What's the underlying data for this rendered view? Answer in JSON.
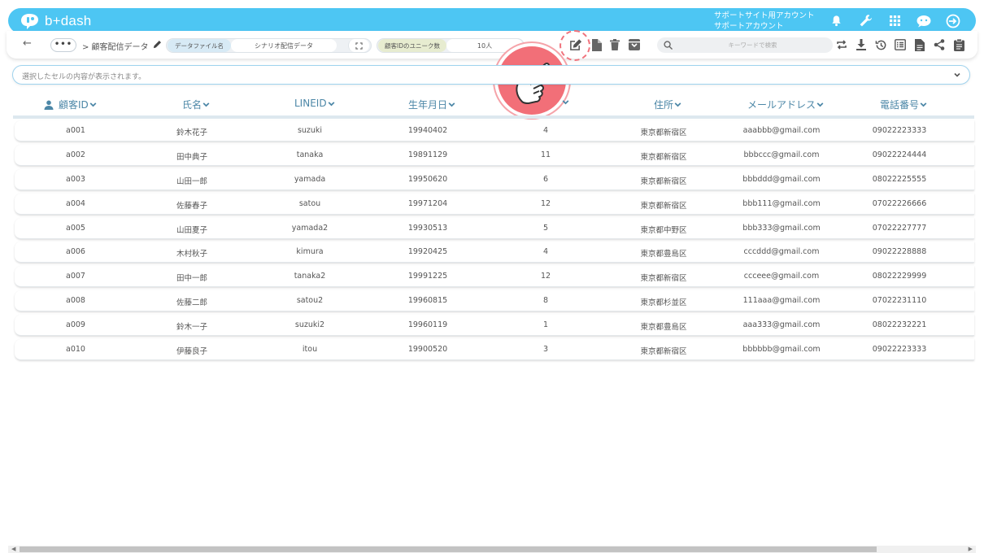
{
  "app": {
    "logo_text": "b+dash",
    "account_line1": "サポートサイト用アカウント",
    "account_line2": "サポートアカウント"
  },
  "toolbar": {
    "breadcrumb": "> 顧客配信データ",
    "data_file_chip": "データファイル名",
    "data_file_value": "シナリオ配信データ",
    "unique_chip": "顧客IDのユニーク数",
    "unique_value": "10人",
    "search_placeholder": "キーワードで検索"
  },
  "cell_bar": {
    "placeholder": "選択したセルの内容が表示されます。"
  },
  "table": {
    "columns": [
      "顧客ID",
      "氏名",
      "LINEID",
      "生年月日",
      "",
      "住所",
      "メールアドレス",
      "電話番号"
    ],
    "rows": [
      [
        "a001",
        "鈴木花子",
        "suzuki",
        "19940402",
        "4",
        "東京都新宿区",
        "aaabbb@gmail.com",
        "09022223333"
      ],
      [
        "a002",
        "田中典子",
        "tanaka",
        "19891129",
        "11",
        "東京都新宿区",
        "bbbccc@gmail.com",
        "09022224444"
      ],
      [
        "a003",
        "山田一郎",
        "yamada",
        "19950620",
        "6",
        "東京都新宿区",
        "bbbddd@gmail.com",
        "08022225555"
      ],
      [
        "a004",
        "佐藤春子",
        "satou",
        "19971204",
        "12",
        "東京都新宿区",
        "bbb111@gmail.com",
        "07022226666"
      ],
      [
        "a005",
        "山田夏子",
        "yamada2",
        "19930513",
        "5",
        "東京都中野区",
        "bbb333@gmail.com",
        "07022227777"
      ],
      [
        "a006",
        "木村秋子",
        "kimura",
        "19920425",
        "4",
        "東京都豊島区",
        "cccddd@gmail.com",
        "09022228888"
      ],
      [
        "a007",
        "田中一郎",
        "tanaka2",
        "19991225",
        "12",
        "東京都新宿区",
        "ccceee@gmail.com",
        "08022229999"
      ],
      [
        "a008",
        "佐藤二郎",
        "satou2",
        "19960815",
        "8",
        "東京都杉並区",
        "111aaa@gmail.com",
        "07022231110"
      ],
      [
        "a009",
        "鈴木一子",
        "suzuki2",
        "19960119",
        "1",
        "東京都豊島区",
        "aaa333@gmail.com",
        "08022232221"
      ],
      [
        "a010",
        "伊藤良子",
        "itou",
        "19900520",
        "3",
        "東京都新宿区",
        "bbbbbb@gmail.com",
        "09022223333"
      ]
    ]
  },
  "icons": {
    "top": [
      "bell-icon",
      "wrench-icon",
      "grid-icon",
      "chat-bot-icon",
      "logout-icon"
    ],
    "tools": [
      "edit-icon",
      "file-icon",
      "trash-icon",
      "archive-icon"
    ],
    "right_tools": [
      "swap-icon",
      "download-icon",
      "history-icon",
      "list-icon",
      "document-icon",
      "share-icon",
      "clipboard-icon"
    ]
  },
  "colors": {
    "brand": "#4dc6f3",
    "header_text": "#4c87a7",
    "highlight": "#f26f78"
  }
}
